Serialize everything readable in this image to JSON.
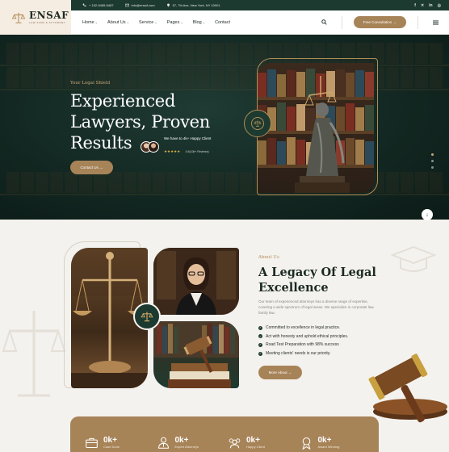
{
  "brand": {
    "name": "ENSAF",
    "tagline": "LAW FIRM & ATTORNEY"
  },
  "topbar": {
    "phone": "+ 152-5485-5487",
    "email": "info@ensaf.com",
    "address": "57, 7th Ave, New York, NY 10001",
    "social": [
      "f",
      "✕",
      "in",
      "◎"
    ]
  },
  "nav": {
    "items": [
      {
        "label": "Home",
        "dropdown": true
      },
      {
        "label": "About Us",
        "dropdown": true
      },
      {
        "label": "Service",
        "dropdown": true
      },
      {
        "label": "Pages",
        "dropdown": true
      },
      {
        "label": "Blog",
        "dropdown": true
      },
      {
        "label": "Contact",
        "dropdown": false
      }
    ],
    "cta": "Free Consultation →"
  },
  "hero": {
    "kicker": "Your Legal Shield",
    "title": "Experienced\nLawyers, Proven\nResults",
    "clients_line": "We have to 4k+ Happy Client",
    "stars": "★★★★★",
    "rating": "4.5(10k+ Reviews)",
    "cta": "Contact Us →"
  },
  "about": {
    "kicker": "About Us",
    "title": "A Legacy Of Legal\nExcellence",
    "description": "Our team of experienced attorneys has a diverse range of expertise, covering a wide spectrum of legal areas. We specialize in corporate law, family law.",
    "checklist": [
      "Committed to excellence in legal practice.",
      "Act with honesty and uphold ethical principles.",
      "Road Test Preparation with 98% success",
      "Meeting clients' needs is our priority."
    ],
    "cta": "More About →"
  },
  "stats": [
    {
      "value": "0k+",
      "label": "Case Done",
      "icon": "briefcase-icon"
    },
    {
      "value": "0k+",
      "label": "Expert Attorneys",
      "icon": "attorney-icon"
    },
    {
      "value": "0k+",
      "label": "Happy Client",
      "icon": "happy-client-icon"
    },
    {
      "value": "0k+",
      "label": "Award Winning",
      "icon": "award-icon"
    }
  ],
  "colors": {
    "primary": "#1d3a30",
    "accent": "#a78358",
    "background": "#f4f2ee"
  }
}
